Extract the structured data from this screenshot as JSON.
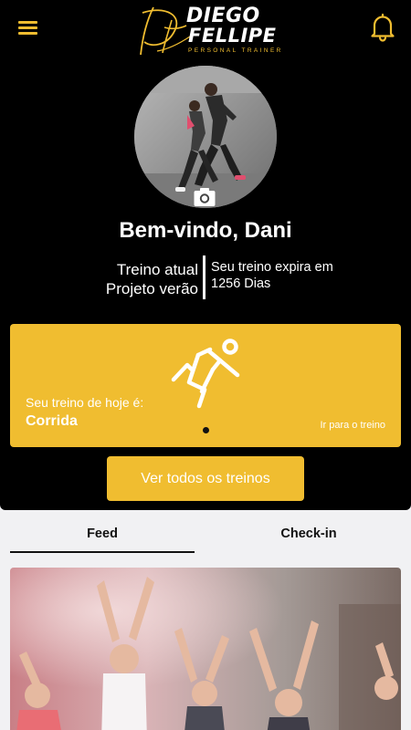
{
  "header": {
    "menu_icon": "hamburger-menu-icon",
    "notification_icon": "bell-icon",
    "logo": {
      "monogram": "DF",
      "line1": "DIEGO",
      "line2": "FELLIPE",
      "tagline": "PERSONAL TRAINER"
    }
  },
  "profile": {
    "camera_icon": "camera-icon",
    "welcome": "Bem-vindo, Dani",
    "current_label": "Treino atual",
    "current_program": "Projeto verão",
    "expire_label": "Seu treino expira em",
    "expire_value": "1256 Dias"
  },
  "today_card": {
    "icon": "running-person-icon",
    "title": "Seu treino de hoje é:",
    "workout": "Corrida",
    "link": "Ir para o treino",
    "pagination_index": 1,
    "pagination_total": 1
  },
  "view_all_button": "Ver todos os treinos",
  "tabs": [
    {
      "label": "Feed",
      "active": true
    },
    {
      "label": "Check-in",
      "active": false
    }
  ],
  "colors": {
    "accent": "#f0bd30",
    "hero_background": "#000000",
    "page_background": "#f1f1f3",
    "text_dark": "#111111"
  }
}
